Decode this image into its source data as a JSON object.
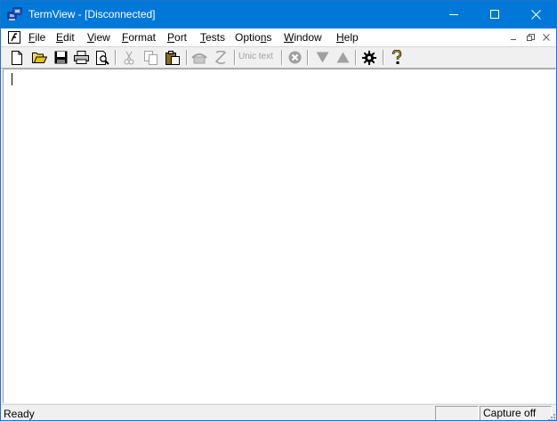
{
  "window": {
    "title": "TermView - [Disconnected]"
  },
  "menu": {
    "items": [
      {
        "label": "File",
        "mnemonic": "F",
        "rest": "ile"
      },
      {
        "label": "Edit",
        "mnemonic": "E",
        "rest": "dit"
      },
      {
        "label": "View",
        "mnemonic": "V",
        "rest": "iew"
      },
      {
        "label": "Format",
        "mnemonic": "F",
        "rest": "ormat"
      },
      {
        "label": "Port",
        "mnemonic": "P",
        "rest": "ort"
      },
      {
        "label": "Tests",
        "mnemonic": "T",
        "rest": "ests"
      },
      {
        "label": "Options",
        "pre": "Optio",
        "mnemonic": "n",
        "rest": "s"
      },
      {
        "label": "Window",
        "mnemonic": "W",
        "rest": "indow"
      },
      {
        "label": "Help",
        "mnemonic": "H",
        "rest": "elp"
      }
    ]
  },
  "toolbar": {
    "text_label": "Unic text",
    "icons": [
      "new-icon",
      "open-icon",
      "save-icon",
      "print-icon",
      "print-preview-icon",
      "cut-icon",
      "copy-icon",
      "paste-icon",
      "connect-icon",
      "disconnect-icon",
      "stop-icon",
      "arrow-down-icon",
      "arrow-up-icon",
      "settings-icon",
      "help-icon"
    ]
  },
  "status": {
    "ready": "Ready",
    "pane1": "",
    "capture": "Capture off"
  },
  "colors": {
    "titlebar": "#0078d7",
    "accent_icon": "#c8a000"
  }
}
